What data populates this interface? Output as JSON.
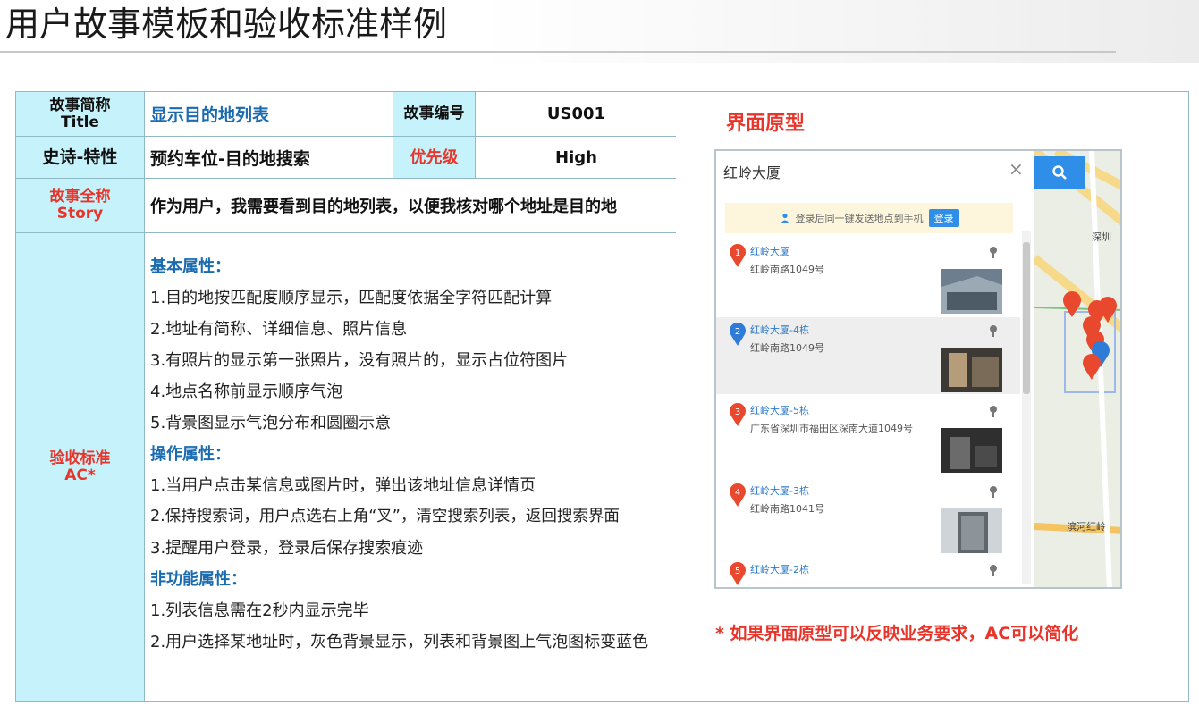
{
  "page": {
    "title": "用户故事模板和验收标准样例"
  },
  "table": {
    "title_label_cn": "故事简称",
    "title_label_en": "Title",
    "title_value": "显示目的地列表",
    "id_label": "故事编号",
    "id_value": "US001",
    "epic_label": "史诗-特性",
    "epic_value": "预约车位-目的地搜索",
    "priority_label": "优先级",
    "priority_value": "High",
    "story_label_cn": "故事全称",
    "story_label_en": "Story",
    "story_value": "作为用户，我需要看到目的地列表，以便我核对哪个地址是目的地",
    "ac_label_cn": "验收标准",
    "ac_label_en": "AC*",
    "ac": {
      "basic_head": "基本属性：",
      "basic": [
        "1.目的地按匹配度顺序显示，匹配度依据全字符匹配计算",
        "2.地址有简称、详细信息、照片信息",
        "3.有照片的显示第一张照片，没有照片的，显示占位符图片",
        "4.地点名称前显示顺序气泡",
        "5.背景图显示气泡分布和圆圈示意"
      ],
      "op_head": "操作属性：",
      "op": [
        "1.当用户点击某信息或图片时，弹出该地址信息详情页",
        "2.保持搜索词，用户点选右上角“叉”，清空搜索列表，返回搜索界面",
        "3.提醒用户登录，登录后保存搜索痕迹"
      ],
      "nf_head": "非功能属性：",
      "nf": [
        "1.列表信息需在2秒内显示完毕",
        "2.用户选择某地址时，灰色背景显示，列表和背景图上气泡图标变蓝色"
      ]
    }
  },
  "prototype": {
    "title": "界面原型",
    "note": "* 如果界面原型可以反映业务要求，AC可以简化",
    "search_text": "红岭大厦",
    "close_symbol": "×",
    "login_hint": "登录后同一键发送地点到手机",
    "login_button": "登录",
    "results": [
      {
        "num": "1",
        "name": "红岭大厦",
        "addr": "红岭南路1049号"
      },
      {
        "num": "2",
        "name": "红岭大厦-4栋",
        "addr": "红岭南路1049号"
      },
      {
        "num": "3",
        "name": "红岭大厦-5栋",
        "addr": "广东省深圳市福田区深南大道1049号"
      },
      {
        "num": "4",
        "name": "红岭大厦-3栋",
        "addr": "红岭南路1041号"
      },
      {
        "num": "5",
        "name": "红岭大厦-2栋",
        "addr": ""
      }
    ],
    "map_labels": [
      "深圳",
      "滨河红岭"
    ],
    "colors": {
      "pin_red": "#e8482d",
      "pin_blue": "#2f7bd8",
      "accent": "#2f8fe8"
    }
  }
}
